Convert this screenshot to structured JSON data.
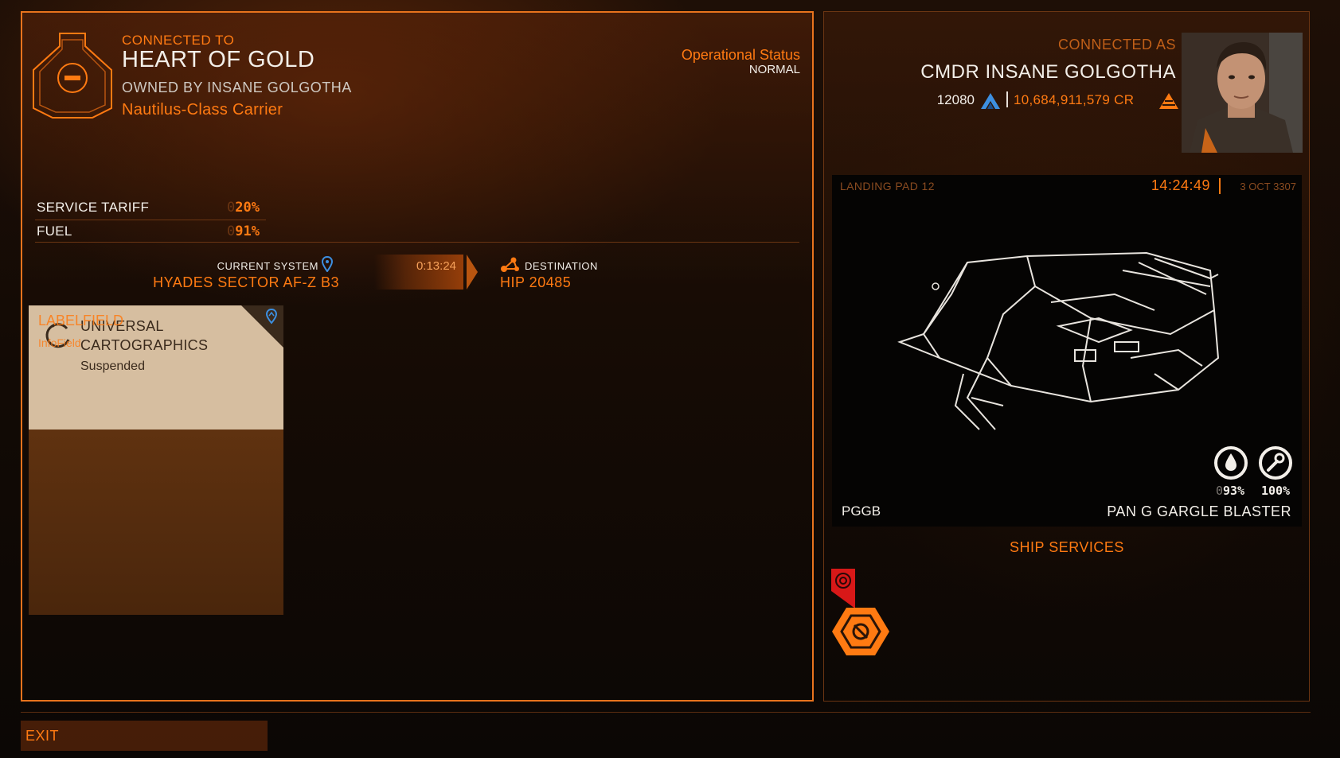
{
  "carrier": {
    "connected_to_label": "CONNECTED TO",
    "name": "HEART OF GOLD",
    "owned_by": "OWNED BY INSANE GOLGOTHA",
    "class": "Nautilus-Class Carrier",
    "operational_status_label": "Operational Status",
    "operational_status_value": "NORMAL",
    "logo_icon": "carrier-emblem-icon"
  },
  "stats": [
    {
      "label": "SERVICE TARIFF",
      "value_lead": "0",
      "value": "20%"
    },
    {
      "label": "FUEL",
      "value_lead": "0",
      "value": "91%"
    }
  ],
  "navigation": {
    "current_system_label": "CURRENT SYSTEM",
    "current_system": "HYADES SECTOR AF-Z B3",
    "jump_timer": "0:13:24",
    "destination_label": "DESTINATION",
    "destination": "HIP 20485"
  },
  "service_card": {
    "title_line1": "UNIVERSAL",
    "title_line2": "CARTOGRAPHICS",
    "status": "Suspended",
    "overlay_label": "LABELFIELD",
    "overlay_sub": "InfoField"
  },
  "commander": {
    "connected_as_label": "CONNECTED AS",
    "name": "CMDR INSANE GOLGOTHA",
    "rank_value": "12080",
    "credits": "10,684,911,579 CR"
  },
  "ship": {
    "landing_pad": "LANDING PAD 12",
    "time": "14:24:49",
    "date": "3 OCT 3307",
    "fuel_lead": "0",
    "fuel_pct": "93%",
    "repair_pct": "100%",
    "ident": "PGGB",
    "model": "PAN G GARGLE BLASTER"
  },
  "ship_services_label": "SHIP SERVICES",
  "exit_label": "EXIT",
  "colors": {
    "accent": "#ff7a12",
    "text_light": "#f3efe9",
    "card_bg": "#d6bea0",
    "blue_icon": "#3d8fe0",
    "warning_red": "#d81818"
  }
}
